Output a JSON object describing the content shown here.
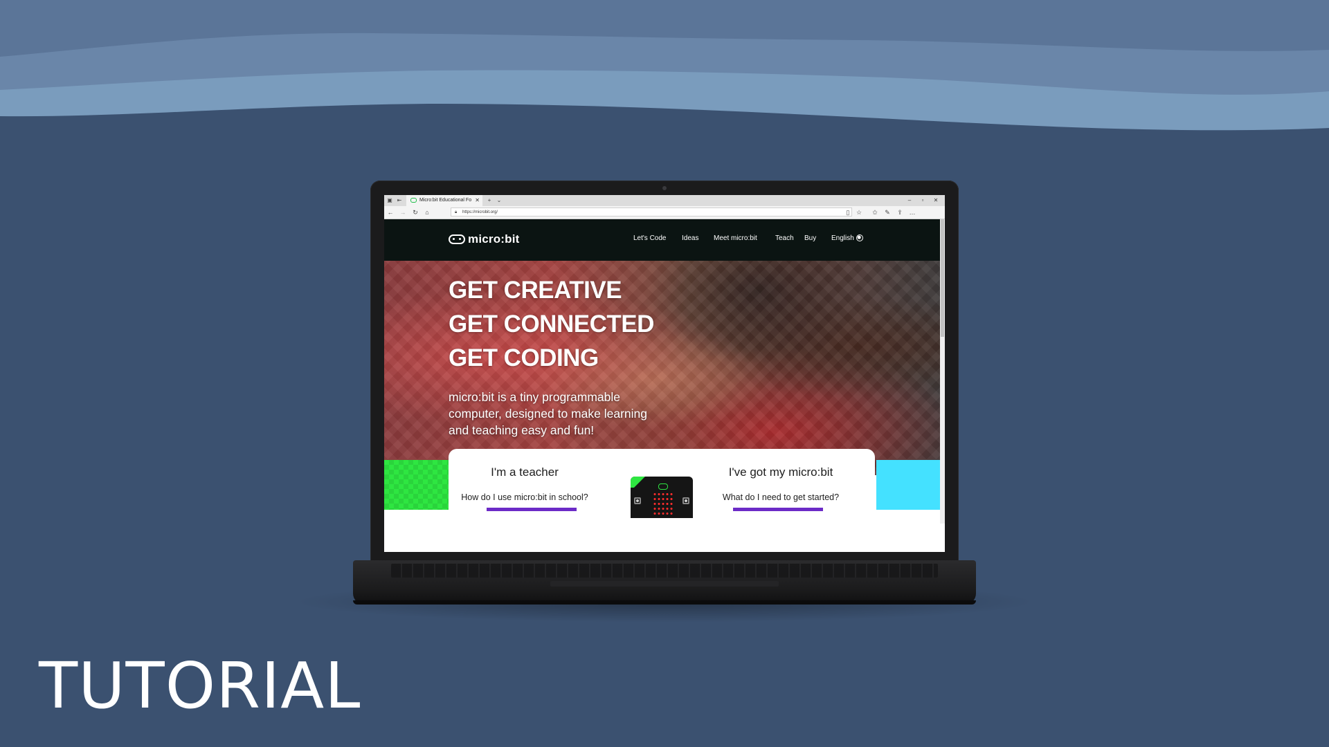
{
  "colors": {
    "page_background": "#3b5170",
    "wave_light": "#7a9cbd",
    "wave_mid": "#5b7598",
    "accent_green": "#2ee641",
    "accent_cyan": "#44e1ff",
    "accent_purple": "#6c2bc7",
    "site_header": "#0b1412"
  },
  "browser": {
    "tab_title": "Micro:bit Educational Fo",
    "tab_close_icon": "close-icon",
    "new_tab_icon": "plus-icon",
    "tab_list_icon": "chevron-down-icon",
    "url": "https://microbit.org/",
    "window_controls": [
      "minimize-icon",
      "maximize-icon",
      "close-icon"
    ],
    "toolbar_icons": [
      "reading-list-icon",
      "favorites-icon",
      "pen-icon",
      "share-icon",
      "more-icon"
    ]
  },
  "site": {
    "logo_text": "micro:bit",
    "nav": {
      "lets_code": "Let's Code",
      "ideas": "Ideas",
      "meet": "Meet micro:bit",
      "teach": "Teach",
      "buy": "Buy",
      "language": "English"
    },
    "hero": {
      "line1": "GET CREATIVE",
      "line2": "GET CONNECTED",
      "line3": "GET CODING",
      "subtitle": "micro:bit is a tiny programmable computer, designed to make learning and teaching easy and fun!"
    },
    "cards": {
      "teacher": {
        "title": "I'm a teacher",
        "subtitle": "How do I use micro:bit in school?"
      },
      "got_microbit": {
        "title": "I've got my micro:bit",
        "subtitle": "What do I need to get started?"
      }
    }
  },
  "caption": "TUTORIAL"
}
